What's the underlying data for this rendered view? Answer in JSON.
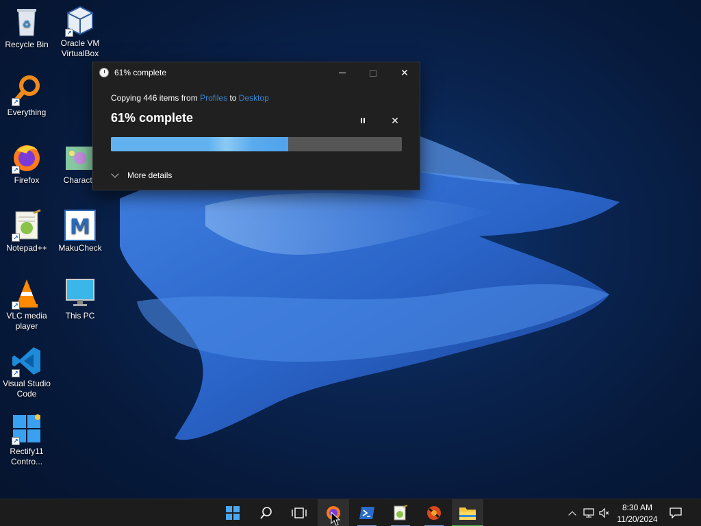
{
  "desktop": {
    "icons": [
      {
        "label": "Recycle Bin",
        "icon": "recycle-bin-icon"
      },
      {
        "label": "Oracle VM VirtualBox",
        "icon": "virtualbox-icon"
      },
      {
        "label": "Everything",
        "icon": "everything-search-icon"
      },
      {
        "label": "Firefox",
        "icon": "firefox-icon"
      },
      {
        "label": "Characte",
        "icon": "character-app-icon"
      },
      {
        "label": "Notepad++",
        "icon": "notepad-plus-plus-icon"
      },
      {
        "label": "MakuCheck",
        "icon": "makucheck-icon"
      },
      {
        "label": "VLC media player",
        "icon": "vlc-icon"
      },
      {
        "label": "This PC",
        "icon": "this-pc-icon"
      },
      {
        "label": "Visual Studio Code",
        "icon": "vscode-icon"
      },
      {
        "label": "Rectify11 Contro...",
        "icon": "rectify11-icon"
      }
    ]
  },
  "dialog": {
    "title": "61% complete",
    "copy_prefix": "Copying 446 items from",
    "source": "Profiles",
    "copy_to": "to",
    "destination": "Desktop",
    "heading": "61% complete",
    "progress_percent": 61,
    "more_details": "More details",
    "colors": {
      "accent": "#62b2ef",
      "link": "#3a86d4",
      "background": "#202020"
    }
  },
  "taskbar": {
    "buttons": [
      "start-icon",
      "search-icon",
      "task-view-icon",
      "firefox-icon",
      "powershell-icon",
      "notepad-plus-plus-icon",
      "app-icon",
      "file-explorer-icon"
    ],
    "tray_icons": [
      "chevron-up-icon",
      "network-icon",
      "volume-muted-icon"
    ],
    "time": "8:30 AM",
    "date": "11/20/2024"
  }
}
